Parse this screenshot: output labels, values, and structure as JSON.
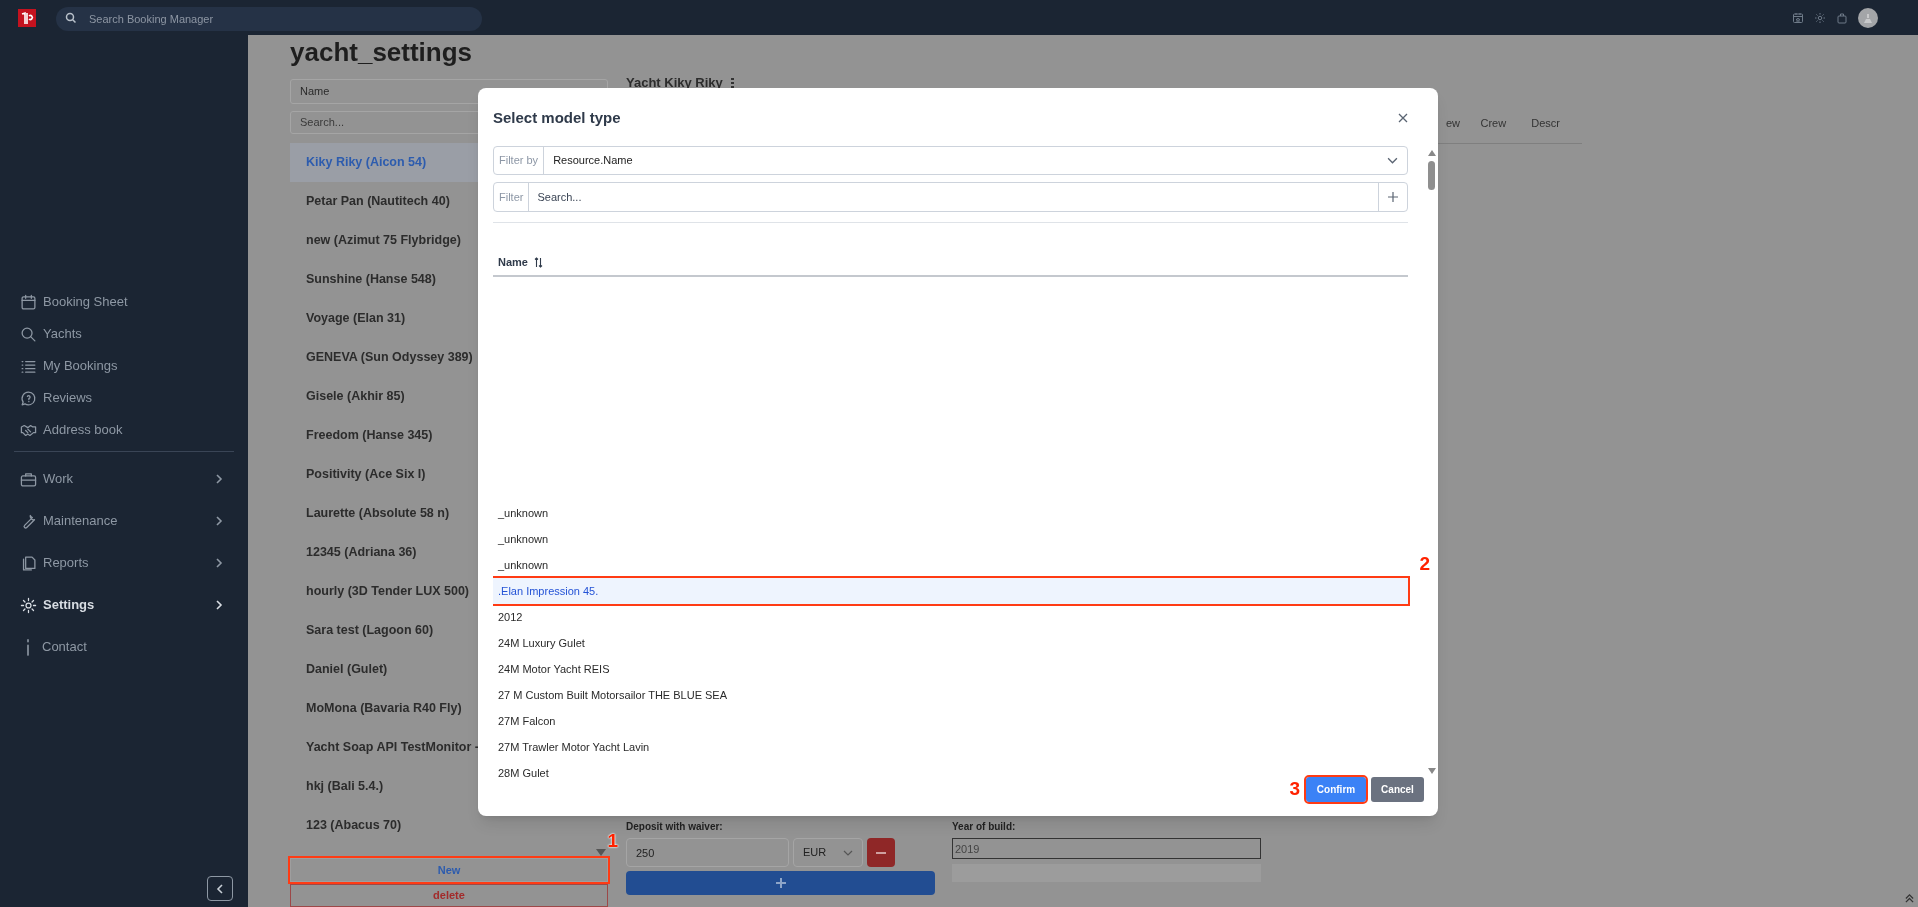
{
  "top_bar": {
    "search_placeholder": "Search Booking Manager"
  },
  "sidebar": {
    "links": [
      {
        "label": "Booking Sheet",
        "has_submenu": false,
        "selected": false
      },
      {
        "label": "Yachts",
        "has_submenu": false,
        "selected": false
      },
      {
        "label": "My Bookings",
        "has_submenu": false,
        "selected": false
      },
      {
        "label": "Reviews",
        "has_submenu": false,
        "selected": false
      },
      {
        "label": "Address book",
        "has_submenu": false,
        "selected": false
      }
    ],
    "sections": [
      {
        "label": "Work",
        "has_submenu": true,
        "selected": false
      },
      {
        "label": "Maintenance",
        "has_submenu": true,
        "selected": false
      },
      {
        "label": "Reports",
        "has_submenu": true,
        "selected": false
      },
      {
        "label": "Settings",
        "has_submenu": true,
        "selected": true
      },
      {
        "label": "Contact",
        "has_submenu": false,
        "selected": false
      }
    ]
  },
  "page": {
    "title": "yacht_settings",
    "sort_select": "Name",
    "search_placeholder": "Search...",
    "yachts": [
      {
        "label": "Kiky Riky (Aicon 54)",
        "selected": true
      },
      {
        "label": "Petar Pan (Nautitech 40)",
        "selected": false
      },
      {
        "label": "new (Azimut 75 Flybridge)",
        "selected": false
      },
      {
        "label": "Sunshine (Hanse 548)",
        "selected": false
      },
      {
        "label": "Voyage (Elan 31)",
        "selected": false
      },
      {
        "label": "GENEVA (Sun Odyssey 389)",
        "selected": false
      },
      {
        "label": "Gisele (Akhir 85)",
        "selected": false
      },
      {
        "label": "Freedom (Hanse 345)",
        "selected": false
      },
      {
        "label": "Positivity (Ace Six I)",
        "selected": false
      },
      {
        "label": "Laurette (Absolute 58 n)",
        "selected": false
      },
      {
        "label": "12345 (Adriana 36)",
        "selected": false
      },
      {
        "label": "hourly (3D Tender LUX 500)",
        "selected": false
      },
      {
        "label": "Sara test (Lagoon 60)",
        "selected": false
      },
      {
        "label": "Daniel (Gulet)",
        "selected": false
      },
      {
        "label": "MoMona (Bavaria R40 Fly)",
        "selected": false
      },
      {
        "label": "Yacht Soap API TestMonitor -",
        "selected": false
      },
      {
        "label": "hkj (Bali 5.4.)",
        "selected": false
      },
      {
        "label": "123 (Abacus 70)",
        "selected": false
      }
    ],
    "new_button": {
      "label": "New",
      "callout": "1"
    },
    "delete_button": {
      "label": "delete"
    },
    "detail": {
      "heading": "Yacht Kiky Riky",
      "tabs": [
        {
          "label": "ew"
        },
        {
          "label": "Crew"
        },
        {
          "label": "Descr"
        }
      ],
      "deposit_label": "Deposit with waiver:",
      "deposit_value": "250",
      "currency": "EUR",
      "year_label": "Year of build:",
      "year_value": "2019"
    }
  },
  "modal": {
    "title": "Select model type",
    "filter_by": {
      "prefix": "Filter by",
      "value": "Resource.Name"
    },
    "filter": {
      "prefix": "Filter",
      "placeholder": "Search..."
    },
    "column": "Name",
    "rows": [
      {
        "label": "_unknown",
        "selected": false
      },
      {
        "label": "_unknown",
        "selected": false
      },
      {
        "label": "_unknown",
        "selected": false
      },
      {
        "label": ".Elan Impression 45.",
        "selected": true,
        "callout": "2"
      },
      {
        "label": "2012",
        "selected": false
      },
      {
        "label": "24M Luxury Gulet",
        "selected": false
      },
      {
        "label": "24M Motor Yacht REIS",
        "selected": false
      },
      {
        "label": "27 M Custom Built Motorsailor THE BLUE SEA",
        "selected": false
      },
      {
        "label": "27M Falcon",
        "selected": false
      },
      {
        "label": "27M Trawler Motor Yacht Lavin",
        "selected": false
      },
      {
        "label": "28M Gulet",
        "selected": false
      }
    ],
    "confirm": {
      "label": "Confirm",
      "callout": "3"
    },
    "cancel": {
      "label": "Cancel"
    }
  }
}
